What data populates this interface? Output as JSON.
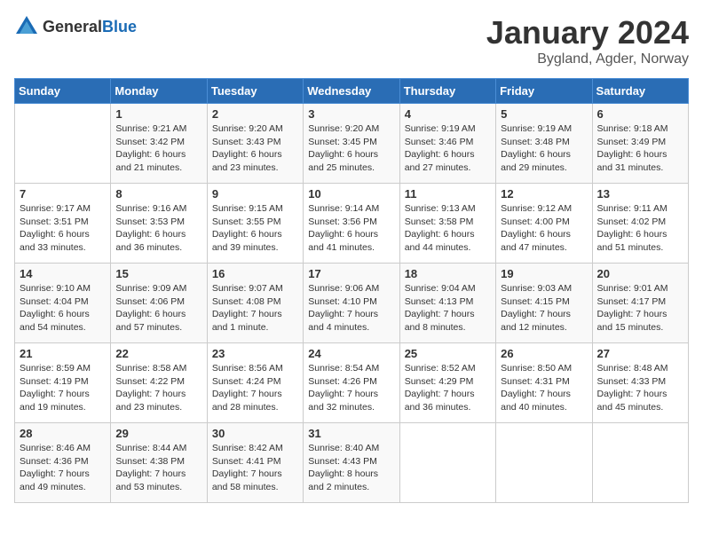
{
  "header": {
    "logo_general": "General",
    "logo_blue": "Blue",
    "title": "January 2024",
    "subtitle": "Bygland, Agder, Norway"
  },
  "columns": [
    "Sunday",
    "Monday",
    "Tuesday",
    "Wednesday",
    "Thursday",
    "Friday",
    "Saturday"
  ],
  "weeks": [
    [
      {
        "day": "",
        "info": ""
      },
      {
        "day": "1",
        "info": "Sunrise: 9:21 AM\nSunset: 3:42 PM\nDaylight: 6 hours\nand 21 minutes."
      },
      {
        "day": "2",
        "info": "Sunrise: 9:20 AM\nSunset: 3:43 PM\nDaylight: 6 hours\nand 23 minutes."
      },
      {
        "day": "3",
        "info": "Sunrise: 9:20 AM\nSunset: 3:45 PM\nDaylight: 6 hours\nand 25 minutes."
      },
      {
        "day": "4",
        "info": "Sunrise: 9:19 AM\nSunset: 3:46 PM\nDaylight: 6 hours\nand 27 minutes."
      },
      {
        "day": "5",
        "info": "Sunrise: 9:19 AM\nSunset: 3:48 PM\nDaylight: 6 hours\nand 29 minutes."
      },
      {
        "day": "6",
        "info": "Sunrise: 9:18 AM\nSunset: 3:49 PM\nDaylight: 6 hours\nand 31 minutes."
      }
    ],
    [
      {
        "day": "7",
        "info": "Sunrise: 9:17 AM\nSunset: 3:51 PM\nDaylight: 6 hours\nand 33 minutes."
      },
      {
        "day": "8",
        "info": "Sunrise: 9:16 AM\nSunset: 3:53 PM\nDaylight: 6 hours\nand 36 minutes."
      },
      {
        "day": "9",
        "info": "Sunrise: 9:15 AM\nSunset: 3:55 PM\nDaylight: 6 hours\nand 39 minutes."
      },
      {
        "day": "10",
        "info": "Sunrise: 9:14 AM\nSunset: 3:56 PM\nDaylight: 6 hours\nand 41 minutes."
      },
      {
        "day": "11",
        "info": "Sunrise: 9:13 AM\nSunset: 3:58 PM\nDaylight: 6 hours\nand 44 minutes."
      },
      {
        "day": "12",
        "info": "Sunrise: 9:12 AM\nSunset: 4:00 PM\nDaylight: 6 hours\nand 47 minutes."
      },
      {
        "day": "13",
        "info": "Sunrise: 9:11 AM\nSunset: 4:02 PM\nDaylight: 6 hours\nand 51 minutes."
      }
    ],
    [
      {
        "day": "14",
        "info": "Sunrise: 9:10 AM\nSunset: 4:04 PM\nDaylight: 6 hours\nand 54 minutes."
      },
      {
        "day": "15",
        "info": "Sunrise: 9:09 AM\nSunset: 4:06 PM\nDaylight: 6 hours\nand 57 minutes."
      },
      {
        "day": "16",
        "info": "Sunrise: 9:07 AM\nSunset: 4:08 PM\nDaylight: 7 hours\nand 1 minute."
      },
      {
        "day": "17",
        "info": "Sunrise: 9:06 AM\nSunset: 4:10 PM\nDaylight: 7 hours\nand 4 minutes."
      },
      {
        "day": "18",
        "info": "Sunrise: 9:04 AM\nSunset: 4:13 PM\nDaylight: 7 hours\nand 8 minutes."
      },
      {
        "day": "19",
        "info": "Sunrise: 9:03 AM\nSunset: 4:15 PM\nDaylight: 7 hours\nand 12 minutes."
      },
      {
        "day": "20",
        "info": "Sunrise: 9:01 AM\nSunset: 4:17 PM\nDaylight: 7 hours\nand 15 minutes."
      }
    ],
    [
      {
        "day": "21",
        "info": "Sunrise: 8:59 AM\nSunset: 4:19 PM\nDaylight: 7 hours\nand 19 minutes."
      },
      {
        "day": "22",
        "info": "Sunrise: 8:58 AM\nSunset: 4:22 PM\nDaylight: 7 hours\nand 23 minutes."
      },
      {
        "day": "23",
        "info": "Sunrise: 8:56 AM\nSunset: 4:24 PM\nDaylight: 7 hours\nand 28 minutes."
      },
      {
        "day": "24",
        "info": "Sunrise: 8:54 AM\nSunset: 4:26 PM\nDaylight: 7 hours\nand 32 minutes."
      },
      {
        "day": "25",
        "info": "Sunrise: 8:52 AM\nSunset: 4:29 PM\nDaylight: 7 hours\nand 36 minutes."
      },
      {
        "day": "26",
        "info": "Sunrise: 8:50 AM\nSunset: 4:31 PM\nDaylight: 7 hours\nand 40 minutes."
      },
      {
        "day": "27",
        "info": "Sunrise: 8:48 AM\nSunset: 4:33 PM\nDaylight: 7 hours\nand 45 minutes."
      }
    ],
    [
      {
        "day": "28",
        "info": "Sunrise: 8:46 AM\nSunset: 4:36 PM\nDaylight: 7 hours\nand 49 minutes."
      },
      {
        "day": "29",
        "info": "Sunrise: 8:44 AM\nSunset: 4:38 PM\nDaylight: 7 hours\nand 53 minutes."
      },
      {
        "day": "30",
        "info": "Sunrise: 8:42 AM\nSunset: 4:41 PM\nDaylight: 7 hours\nand 58 minutes."
      },
      {
        "day": "31",
        "info": "Sunrise: 8:40 AM\nSunset: 4:43 PM\nDaylight: 8 hours\nand 2 minutes."
      },
      {
        "day": "",
        "info": ""
      },
      {
        "day": "",
        "info": ""
      },
      {
        "day": "",
        "info": ""
      }
    ]
  ]
}
